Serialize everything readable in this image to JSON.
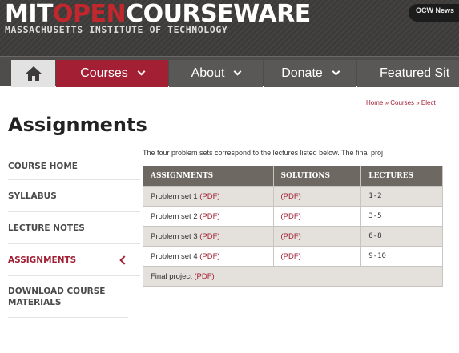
{
  "header": {
    "logo_mit": "MIT",
    "logo_open": "OPEN",
    "logo_courseware": "COURSEWARE",
    "logo_subtitle": "MASSACHUSETTS INSTITUTE OF TECHNOLOGY",
    "ocw_news": "OCW News"
  },
  "nav": {
    "items": [
      {
        "label": "Courses"
      },
      {
        "label": "About"
      },
      {
        "label": "Donate"
      },
      {
        "label": "Featured Sit"
      }
    ]
  },
  "breadcrumb": "Home » Courses » Elect",
  "page_title": "Assignments",
  "sidebar": {
    "items": [
      {
        "label": "COURSE HOME",
        "active": false
      },
      {
        "label": "SYLLABUS",
        "active": false
      },
      {
        "label": "LECTURE NOTES",
        "active": false
      },
      {
        "label": "ASSIGNMENTS",
        "active": true
      },
      {
        "label": "DOWNLOAD COURSE MATERIALS",
        "active": false
      }
    ]
  },
  "content": {
    "intro": "The four problem sets correspond to the lectures listed below. The final proj",
    "table": {
      "headers": [
        "ASSIGNMENTS",
        "SOLUTIONS",
        "LECTURES"
      ],
      "rows": [
        {
          "assignment": "Problem set 1",
          "assignment_link": "(PDF)",
          "solution": "(PDF)",
          "lectures": "1-2"
        },
        {
          "assignment": "Problem set 2",
          "assignment_link": "(PDF)",
          "solution": "(PDF)",
          "lectures": "3-5"
        },
        {
          "assignment": "Problem set 3",
          "assignment_link": "(PDF)",
          "solution": "(PDF)",
          "lectures": "6-8"
        },
        {
          "assignment": "Problem set 4",
          "assignment_link": "(PDF)",
          "solution": "(PDF)",
          "lectures": "9-10"
        }
      ],
      "final_row": {
        "assignment": "Final project",
        "assignment_link": "(PDF)"
      }
    }
  },
  "colors": {
    "brand_red": "#a31f34",
    "header_bg": "#3d3b39",
    "nav_bg": "#5a5856",
    "table_header_bg": "#6e6862",
    "row_shade": "#e4e0dc"
  }
}
